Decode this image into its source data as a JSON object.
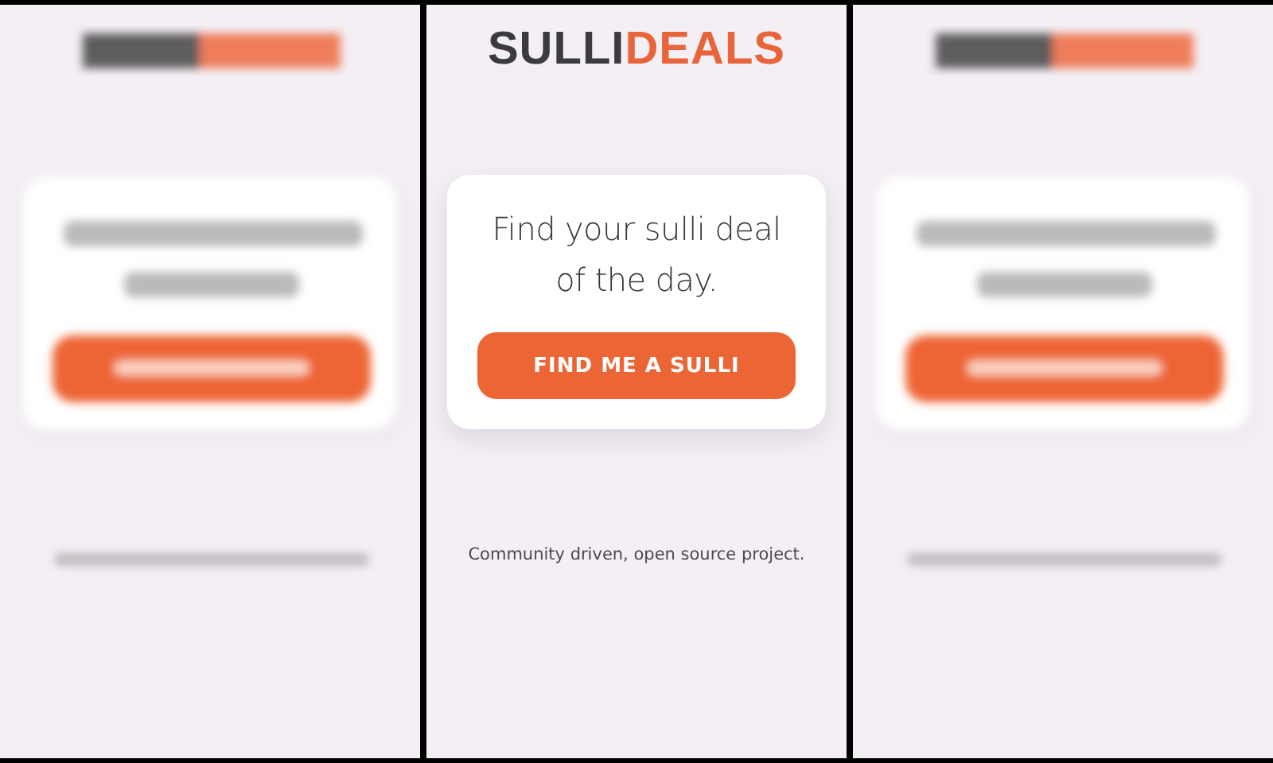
{
  "panels": [
    {
      "kind": "picture"
    },
    {
      "kind": "page",
      "logo": {
        "dark": "SULLI",
        "accent": "DEALS"
      },
      "card": {
        "heading": "Find your sulli deal of the day.",
        "button": "FIND ME A SULLI"
      },
      "footer": "Community driven, open source project."
    },
    {
      "kind": "picture"
    }
  ]
}
